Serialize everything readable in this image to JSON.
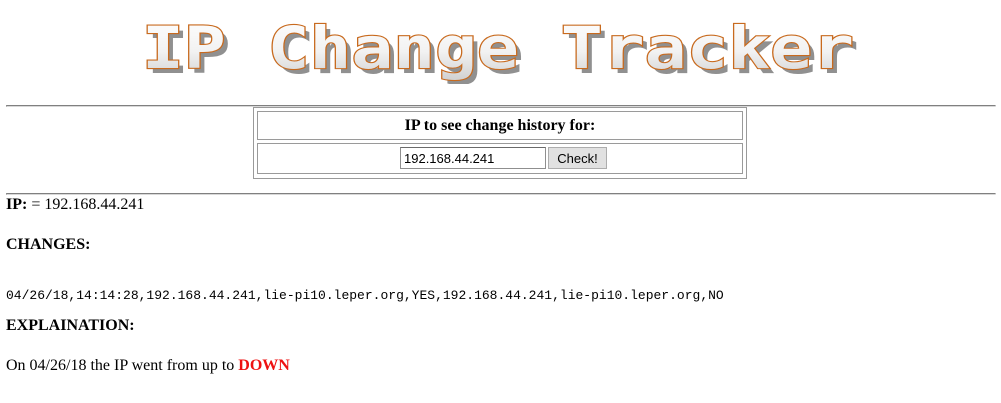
{
  "logo": {
    "text": "IP Change Tracker"
  },
  "form": {
    "heading": "IP to see change history for:",
    "ip_value": "192.168.44.241",
    "check_label": "Check!"
  },
  "result": {
    "ip_label": "IP:",
    "ip_separator": " = ",
    "ip_value": "192.168.44.241",
    "changes_heading": "CHANGES:",
    "change_record": "04/26/18,14:14:28,192.168.44.241,lie-pi10.leper.org,YES,192.168.44.241,lie-pi10.leper.org,NO",
    "explanation_heading": "EXPLAINATION:",
    "explanation_prefix": "On 04/26/18 the IP went from up to ",
    "explanation_status": "DOWN"
  },
  "colors": {
    "logo_fill": "#f4f4f4",
    "logo_outline": "#c86a1e",
    "logo_shadow": "#6b6b6b",
    "status_down": "#ee1111",
    "rule": "#808080"
  }
}
